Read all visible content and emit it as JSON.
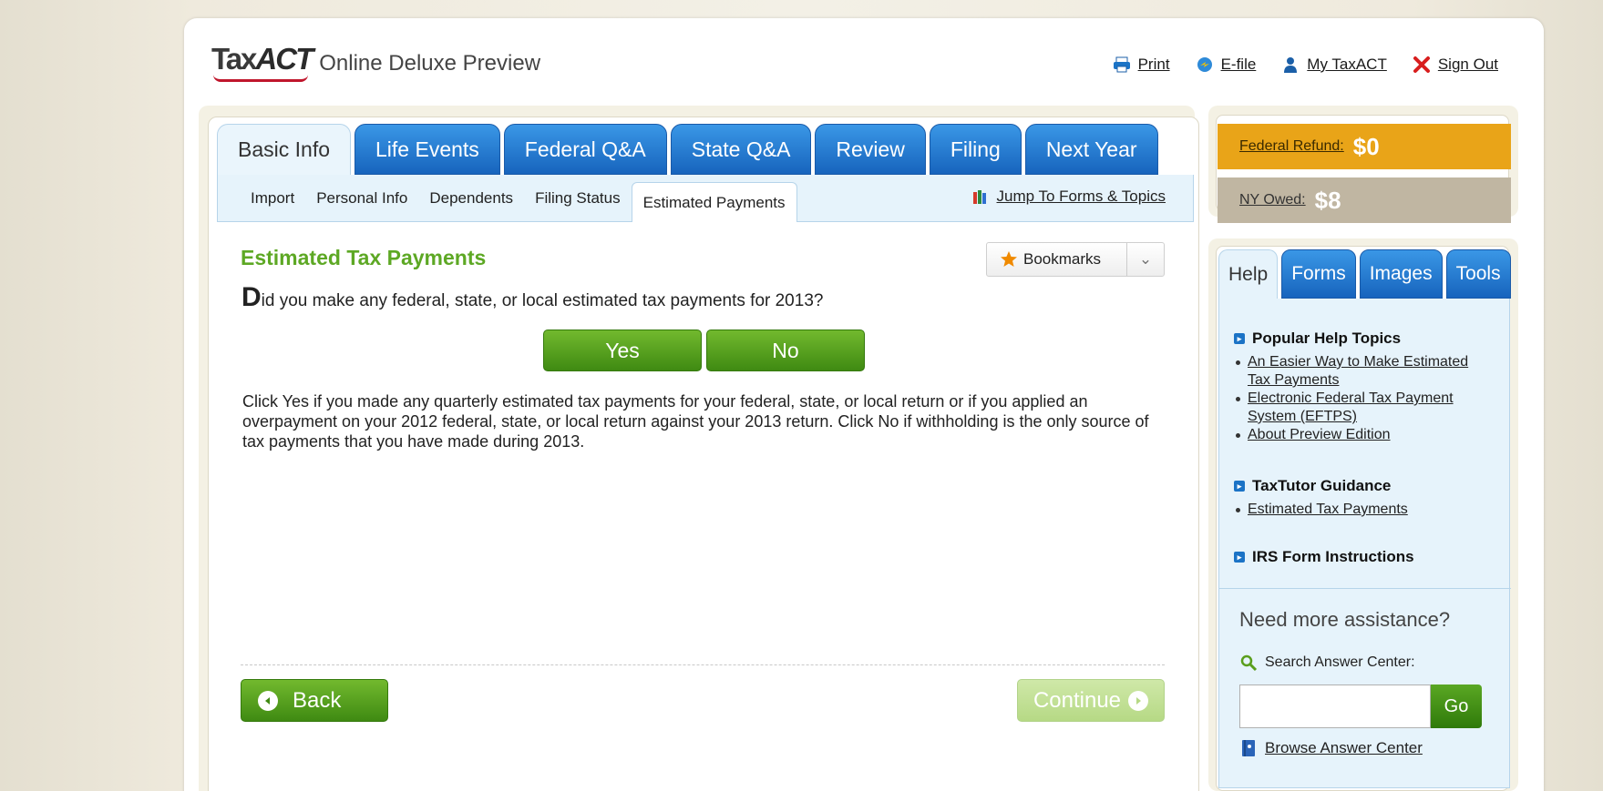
{
  "header": {
    "logo_text_light": "Tax",
    "logo_text_bold": "ACT",
    "logo_subtitle": "Online Deluxe Preview",
    "links": [
      {
        "label": "Print",
        "icon": "printer-icon"
      },
      {
        "label": "E-file",
        "icon": "efile-icon"
      },
      {
        "label": "My TaxACT",
        "icon": "user-icon"
      },
      {
        "label": "Sign Out",
        "icon": "close-icon"
      }
    ]
  },
  "main_tabs": [
    {
      "label": "Basic Info",
      "active": true
    },
    {
      "label": "Life Events"
    },
    {
      "label": "Federal Q&A"
    },
    {
      "label": "State Q&A"
    },
    {
      "label": "Review"
    },
    {
      "label": "Filing"
    },
    {
      "label": "Next Year"
    }
  ],
  "subnav": {
    "items": [
      "Import",
      "Personal Info",
      "Dependents",
      "Filing Status",
      "Estimated Payments"
    ],
    "active_index": 4,
    "jump_label": "Jump To Forms & Topics"
  },
  "content": {
    "title": "Estimated Tax Payments",
    "bookmarks_label": "Bookmarks",
    "question_first": "D",
    "question_rest": "id you make any federal, state, or local estimated tax payments for 2013?",
    "yes_label": "Yes",
    "no_label": "No",
    "description": "Click Yes if you made any quarterly estimated tax payments for your federal, state, or local return or if you applied an overpayment on your 2012 federal, state, or local return against your 2013 return. Click No if withholding is the only source of tax payments that you have made during 2013.",
    "back_label": "Back",
    "continue_label": "Continue"
  },
  "refund": {
    "federal_label": "Federal Refund:",
    "federal_value": "$0",
    "state_label": "NY Owed:",
    "state_value": "$8",
    "federal_color": "#e9a418",
    "state_color": "#c0b6a2"
  },
  "side_tabs": [
    {
      "label": "Help",
      "active": true
    },
    {
      "label": "Forms"
    },
    {
      "label": "Images"
    },
    {
      "label": "Tools"
    }
  ],
  "help": {
    "popular_heading": "Popular Help Topics",
    "popular_links": [
      "An Easier Way to Make Estimated Tax Payments",
      "Electronic Federal Tax Payment System (EFTPS)",
      "About Preview Edition"
    ],
    "taxtutor_heading": "TaxTutor Guidance",
    "taxtutor_links": [
      "Estimated Tax Payments"
    ],
    "irs_heading": "IRS Form Instructions",
    "need_more": "Need more assistance?",
    "search_label": "Search Answer Center:",
    "search_value": "",
    "go_label": "Go",
    "browse_label": "Browse Answer Center"
  },
  "colors": {
    "tab_blue": "#1f74cc",
    "green": "#5da824",
    "accent_red": "#c0162c"
  }
}
